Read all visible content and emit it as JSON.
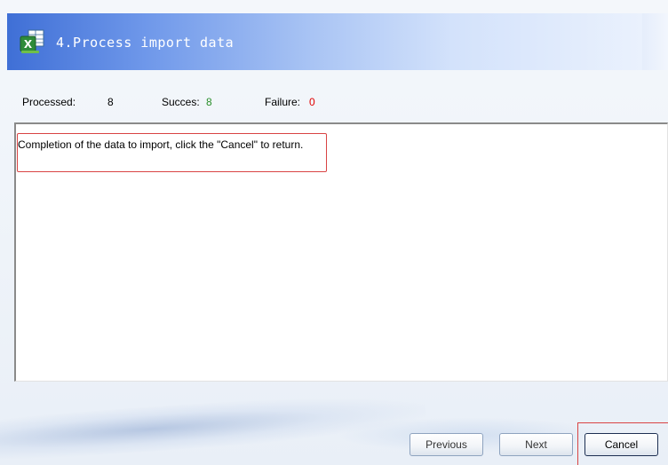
{
  "header": {
    "title": "4.Process import data",
    "icon": "excel-icon"
  },
  "stats": {
    "processed_label": "Processed:",
    "processed_value": "8",
    "success_label": "Succes:",
    "success_value": "8",
    "failure_label": "Failure:",
    "failure_value": "0"
  },
  "log": {
    "message": "Completion of the data to import, click the \"Cancel\" to return."
  },
  "buttons": {
    "previous": "Previous",
    "next": "Next",
    "cancel": "Cancel"
  },
  "colors": {
    "header_start": "#3f6fd6",
    "success": "#2a8f2a",
    "failure": "#e00000",
    "highlight": "#d94444"
  }
}
